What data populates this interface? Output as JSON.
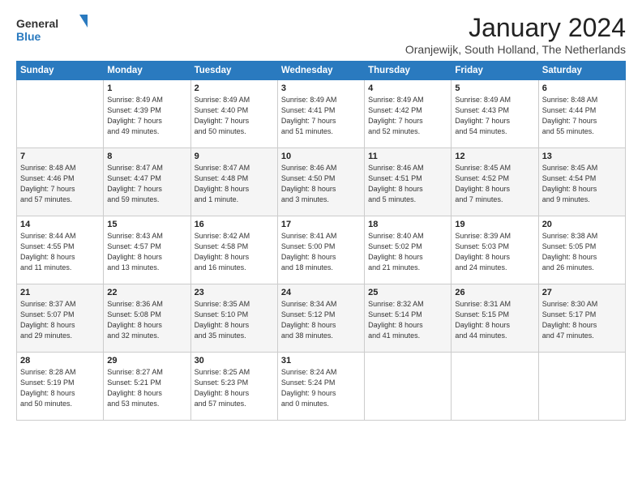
{
  "logo": {
    "general": "General",
    "blue": "Blue"
  },
  "title": "January 2024",
  "subtitle": "Oranjewijk, South Holland, The Netherlands",
  "weekdays": [
    "Sunday",
    "Monday",
    "Tuesday",
    "Wednesday",
    "Thursday",
    "Friday",
    "Saturday"
  ],
  "weeks": [
    [
      {
        "day": "",
        "info": ""
      },
      {
        "day": "1",
        "info": "Sunrise: 8:49 AM\nSunset: 4:39 PM\nDaylight: 7 hours\nand 49 minutes."
      },
      {
        "day": "2",
        "info": "Sunrise: 8:49 AM\nSunset: 4:40 PM\nDaylight: 7 hours\nand 50 minutes."
      },
      {
        "day": "3",
        "info": "Sunrise: 8:49 AM\nSunset: 4:41 PM\nDaylight: 7 hours\nand 51 minutes."
      },
      {
        "day": "4",
        "info": "Sunrise: 8:49 AM\nSunset: 4:42 PM\nDaylight: 7 hours\nand 52 minutes."
      },
      {
        "day": "5",
        "info": "Sunrise: 8:49 AM\nSunset: 4:43 PM\nDaylight: 7 hours\nand 54 minutes."
      },
      {
        "day": "6",
        "info": "Sunrise: 8:48 AM\nSunset: 4:44 PM\nDaylight: 7 hours\nand 55 minutes."
      }
    ],
    [
      {
        "day": "7",
        "info": "Sunrise: 8:48 AM\nSunset: 4:46 PM\nDaylight: 7 hours\nand 57 minutes."
      },
      {
        "day": "8",
        "info": "Sunrise: 8:47 AM\nSunset: 4:47 PM\nDaylight: 7 hours\nand 59 minutes."
      },
      {
        "day": "9",
        "info": "Sunrise: 8:47 AM\nSunset: 4:48 PM\nDaylight: 8 hours\nand 1 minute."
      },
      {
        "day": "10",
        "info": "Sunrise: 8:46 AM\nSunset: 4:50 PM\nDaylight: 8 hours\nand 3 minutes."
      },
      {
        "day": "11",
        "info": "Sunrise: 8:46 AM\nSunset: 4:51 PM\nDaylight: 8 hours\nand 5 minutes."
      },
      {
        "day": "12",
        "info": "Sunrise: 8:45 AM\nSunset: 4:52 PM\nDaylight: 8 hours\nand 7 minutes."
      },
      {
        "day": "13",
        "info": "Sunrise: 8:45 AM\nSunset: 4:54 PM\nDaylight: 8 hours\nand 9 minutes."
      }
    ],
    [
      {
        "day": "14",
        "info": "Sunrise: 8:44 AM\nSunset: 4:55 PM\nDaylight: 8 hours\nand 11 minutes."
      },
      {
        "day": "15",
        "info": "Sunrise: 8:43 AM\nSunset: 4:57 PM\nDaylight: 8 hours\nand 13 minutes."
      },
      {
        "day": "16",
        "info": "Sunrise: 8:42 AM\nSunset: 4:58 PM\nDaylight: 8 hours\nand 16 minutes."
      },
      {
        "day": "17",
        "info": "Sunrise: 8:41 AM\nSunset: 5:00 PM\nDaylight: 8 hours\nand 18 minutes."
      },
      {
        "day": "18",
        "info": "Sunrise: 8:40 AM\nSunset: 5:02 PM\nDaylight: 8 hours\nand 21 minutes."
      },
      {
        "day": "19",
        "info": "Sunrise: 8:39 AM\nSunset: 5:03 PM\nDaylight: 8 hours\nand 24 minutes."
      },
      {
        "day": "20",
        "info": "Sunrise: 8:38 AM\nSunset: 5:05 PM\nDaylight: 8 hours\nand 26 minutes."
      }
    ],
    [
      {
        "day": "21",
        "info": "Sunrise: 8:37 AM\nSunset: 5:07 PM\nDaylight: 8 hours\nand 29 minutes."
      },
      {
        "day": "22",
        "info": "Sunrise: 8:36 AM\nSunset: 5:08 PM\nDaylight: 8 hours\nand 32 minutes."
      },
      {
        "day": "23",
        "info": "Sunrise: 8:35 AM\nSunset: 5:10 PM\nDaylight: 8 hours\nand 35 minutes."
      },
      {
        "day": "24",
        "info": "Sunrise: 8:34 AM\nSunset: 5:12 PM\nDaylight: 8 hours\nand 38 minutes."
      },
      {
        "day": "25",
        "info": "Sunrise: 8:32 AM\nSunset: 5:14 PM\nDaylight: 8 hours\nand 41 minutes."
      },
      {
        "day": "26",
        "info": "Sunrise: 8:31 AM\nSunset: 5:15 PM\nDaylight: 8 hours\nand 44 minutes."
      },
      {
        "day": "27",
        "info": "Sunrise: 8:30 AM\nSunset: 5:17 PM\nDaylight: 8 hours\nand 47 minutes."
      }
    ],
    [
      {
        "day": "28",
        "info": "Sunrise: 8:28 AM\nSunset: 5:19 PM\nDaylight: 8 hours\nand 50 minutes."
      },
      {
        "day": "29",
        "info": "Sunrise: 8:27 AM\nSunset: 5:21 PM\nDaylight: 8 hours\nand 53 minutes."
      },
      {
        "day": "30",
        "info": "Sunrise: 8:25 AM\nSunset: 5:23 PM\nDaylight: 8 hours\nand 57 minutes."
      },
      {
        "day": "31",
        "info": "Sunrise: 8:24 AM\nSunset: 5:24 PM\nDaylight: 9 hours\nand 0 minutes."
      },
      {
        "day": "",
        "info": ""
      },
      {
        "day": "",
        "info": ""
      },
      {
        "day": "",
        "info": ""
      }
    ]
  ]
}
